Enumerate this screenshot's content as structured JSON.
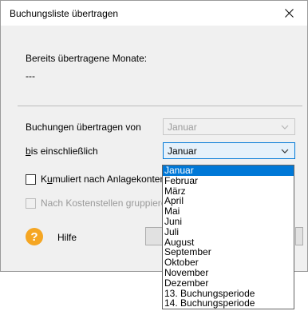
{
  "window": {
    "title": "Buchungsliste übertragen"
  },
  "info": {
    "label": "Bereits übertragene Monate:",
    "value": "---"
  },
  "from": {
    "label": "Buchungen übertragen von",
    "value": "Januar"
  },
  "to": {
    "label": "bis einschließlich",
    "value": "Januar"
  },
  "options": {
    "cumulative_label": "Kumuliert nach Anlagekonten",
    "cost_center_label": "Nach Kostenstellen gruppieren"
  },
  "help": {
    "label": "Hilfe",
    "icon": "question-icon",
    "color": "#f5a623"
  },
  "dropdown": {
    "items": [
      "Januar",
      "Februar",
      "März",
      "April",
      "Mai",
      "Juni",
      "Juli",
      "August",
      "September",
      "Oktober",
      "November",
      "Dezember",
      "13. Buchungsperiode",
      "14. Buchungsperiode"
    ],
    "selected_index": 0
  },
  "colors": {
    "accent": "#0078d7",
    "dialog_bg": "#f0f0f0"
  }
}
